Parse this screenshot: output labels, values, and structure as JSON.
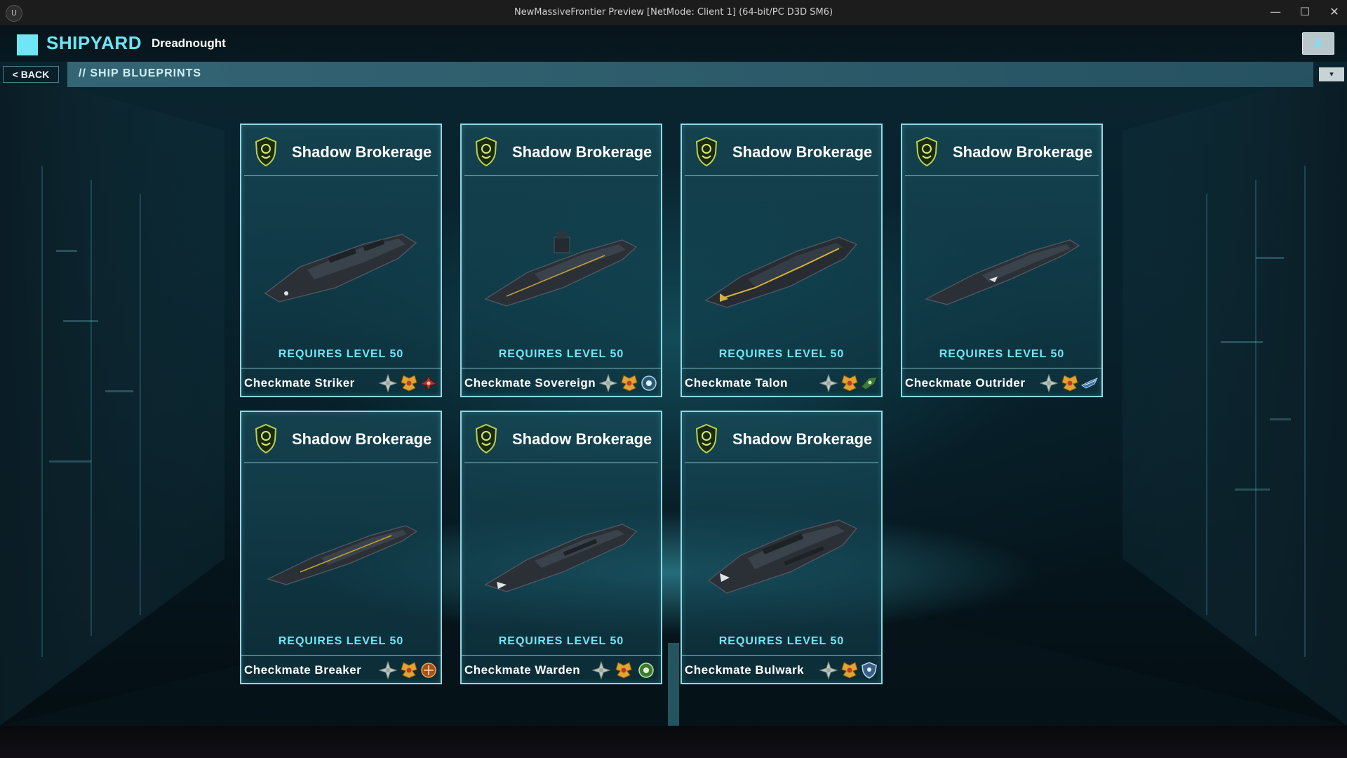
{
  "window": {
    "title": "NewMassiveFrontier Preview [NetMode: Client 1]  (64-bit/PC D3D SM6)",
    "minimize": "—",
    "maximize": "☐",
    "close": "✕"
  },
  "header": {
    "title": "SHIPYARD",
    "ship_class": "Dreadnought",
    "close_label": "X"
  },
  "nav": {
    "back_label": "< BACK",
    "section_title": "// SHIP BLUEPRINTS",
    "dropdown_icon": "▾"
  },
  "colors": {
    "accent": "#6fe6f5",
    "card_border": "#8fd8e3",
    "emblem": "#b9d44a"
  },
  "cards": [
    {
      "faction": "Shadow Brokerage",
      "requirement": "REQUIRES LEVEL 50",
      "name": "Checkmate Striker",
      "icons": [
        "star-rank-icon",
        "gold-wings-icon",
        "red-ship-emblem-icon"
      ]
    },
    {
      "faction": "Shadow Brokerage",
      "requirement": "REQUIRES LEVEL 50",
      "name": "Checkmate Sovereign",
      "icons": [
        "star-rank-icon",
        "gold-wings-icon",
        "blue-crest-icon"
      ]
    },
    {
      "faction": "Shadow Brokerage",
      "requirement": "REQUIRES LEVEL 50",
      "name": "Checkmate Talon",
      "icons": [
        "star-rank-icon",
        "gold-wings-icon",
        "green-ship-emblem-icon"
      ]
    },
    {
      "faction": "Shadow Brokerage",
      "requirement": "REQUIRES LEVEL 50",
      "name": "Checkmate Outrider",
      "icons": [
        "star-rank-icon",
        "gold-wings-icon",
        "blue-ship-emblem-icon"
      ]
    },
    {
      "faction": "Shadow Brokerage",
      "requirement": "REQUIRES LEVEL 50",
      "name": "Checkmate Breaker",
      "icons": [
        "star-rank-icon",
        "gold-wings-icon",
        "orange-crest-icon"
      ]
    },
    {
      "faction": "Shadow Brokerage",
      "requirement": "REQUIRES LEVEL 50",
      "name": "Checkmate Warden",
      "icons": [
        "star-rank-icon",
        "gold-wings-icon",
        "green-crest-icon"
      ]
    },
    {
      "faction": "Shadow Brokerage",
      "requirement": "REQUIRES LEVEL 50",
      "name": "Checkmate Bulwark",
      "icons": [
        "star-rank-icon",
        "gold-wings-icon",
        "blue-shield-icon"
      ]
    }
  ]
}
